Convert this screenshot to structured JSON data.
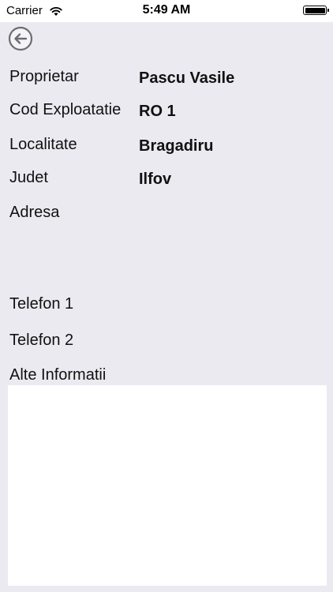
{
  "status_bar": {
    "carrier": "Carrier",
    "time": "5:49 AM"
  },
  "fields": {
    "proprietar": {
      "label": "Proprietar",
      "value": "Pascu Vasile"
    },
    "cod_exploatatie": {
      "label": "Cod Exploatatie",
      "value": "RO 1"
    },
    "localitate": {
      "label": "Localitate",
      "value": "Bragadiru"
    },
    "judet": {
      "label": "Judet",
      "value": "Ilfov"
    },
    "adresa": {
      "label": "Adresa",
      "value": ""
    },
    "telefon1": {
      "label": "Telefon 1",
      "value": ""
    },
    "telefon2": {
      "label": "Telefon 2",
      "value": ""
    },
    "alte_informatii": {
      "label": "Alte Informatii",
      "value": ""
    }
  },
  "icons": {
    "back": "back-arrow-circle-icon",
    "wifi": "wifi-icon",
    "battery": "battery-icon"
  }
}
